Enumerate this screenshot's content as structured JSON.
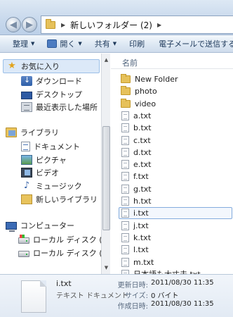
{
  "address": {
    "folder_name": "新しいフォルダー (2)",
    "separator": "▶"
  },
  "toolbar": {
    "organize": "整理",
    "open": "開く",
    "share": "共有",
    "print": "印刷",
    "email": "電子メールで送信する"
  },
  "nav": {
    "favorites": "お気に入り",
    "downloads": "ダウンロード",
    "desktop": "デスクトップ",
    "recent": "最近表示した場所",
    "libraries": "ライブラリ",
    "documents": "ドキュメント",
    "pictures": "ピクチャ",
    "videos": "ビデオ",
    "music": "ミュージック",
    "new_library": "新しいライブラリ",
    "computer": "コンピューター",
    "drive_c": "ローカル ディスク (C:)",
    "drive_d": "ローカル ディスク (D:)"
  },
  "file_list": {
    "column_name": "名前",
    "items": [
      {
        "name": "New Folder",
        "type": "folder"
      },
      {
        "name": "photo",
        "type": "folder"
      },
      {
        "name": "video",
        "type": "folder"
      },
      {
        "name": "a.txt",
        "type": "txt"
      },
      {
        "name": "b.txt",
        "type": "txt"
      },
      {
        "name": "c.txt",
        "type": "txt"
      },
      {
        "name": "d.txt",
        "type": "txt"
      },
      {
        "name": "e.txt",
        "type": "txt"
      },
      {
        "name": "f.txt",
        "type": "txt"
      },
      {
        "name": "g.txt",
        "type": "txt"
      },
      {
        "name": "h.txt",
        "type": "txt"
      },
      {
        "name": "i.txt",
        "type": "txt",
        "selected": true
      },
      {
        "name": "j.txt",
        "type": "txt"
      },
      {
        "name": "k.txt",
        "type": "txt"
      },
      {
        "name": "l.txt",
        "type": "txt"
      },
      {
        "name": "m.txt",
        "type": "txt"
      },
      {
        "name": "日本語も大丈夫.txt",
        "type": "txt"
      }
    ]
  },
  "details": {
    "name": "i.txt",
    "type": "テキスト ドキュメント",
    "modified_label": "更新日時:",
    "modified_value": "2011/08/30 11:35",
    "size_label": "サイズ:",
    "size_value": "0 バイト",
    "created_label": "作成日時:",
    "created_value": "2011/08/30 11:35"
  }
}
